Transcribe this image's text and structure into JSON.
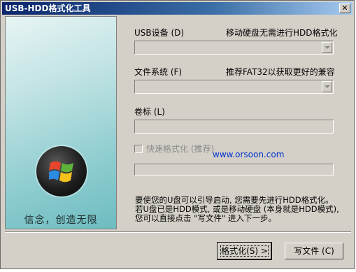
{
  "window": {
    "title": "USB-HDD格式化工具",
    "close_glyph": "✕"
  },
  "left_panel": {
    "slogan": "信念，创造无限",
    "logo_icon": "windows-logo-icon"
  },
  "form": {
    "usb_device_label": "USB设备 (D)",
    "usb_device_hint": "移动硬盘无需进行HDD格式化",
    "usb_device_value": "",
    "filesystem_label": "文件系统 (F)",
    "filesystem_hint": "推荐FAT32以获取更好的兼容",
    "filesystem_value": "",
    "volume_label": "卷标 (L)",
    "volume_value": "",
    "quick_format_label": "快速格式化 (推荐)",
    "quick_format_checked": false,
    "progress": 0
  },
  "watermark": "www.orsoon.com",
  "info": {
    "line1": "要使您的U盘可以引导启动, 您需要先进行HDD格式化。",
    "line2": "若U盘已是HDD模式, 或是移动硬盘 (本身就是HDD模式),",
    "line3": "您可以直接点击 \"写文件\" 进入下一步。"
  },
  "buttons": {
    "format_label": "格式化(S) >",
    "write_label": "写文件 (C)"
  }
}
